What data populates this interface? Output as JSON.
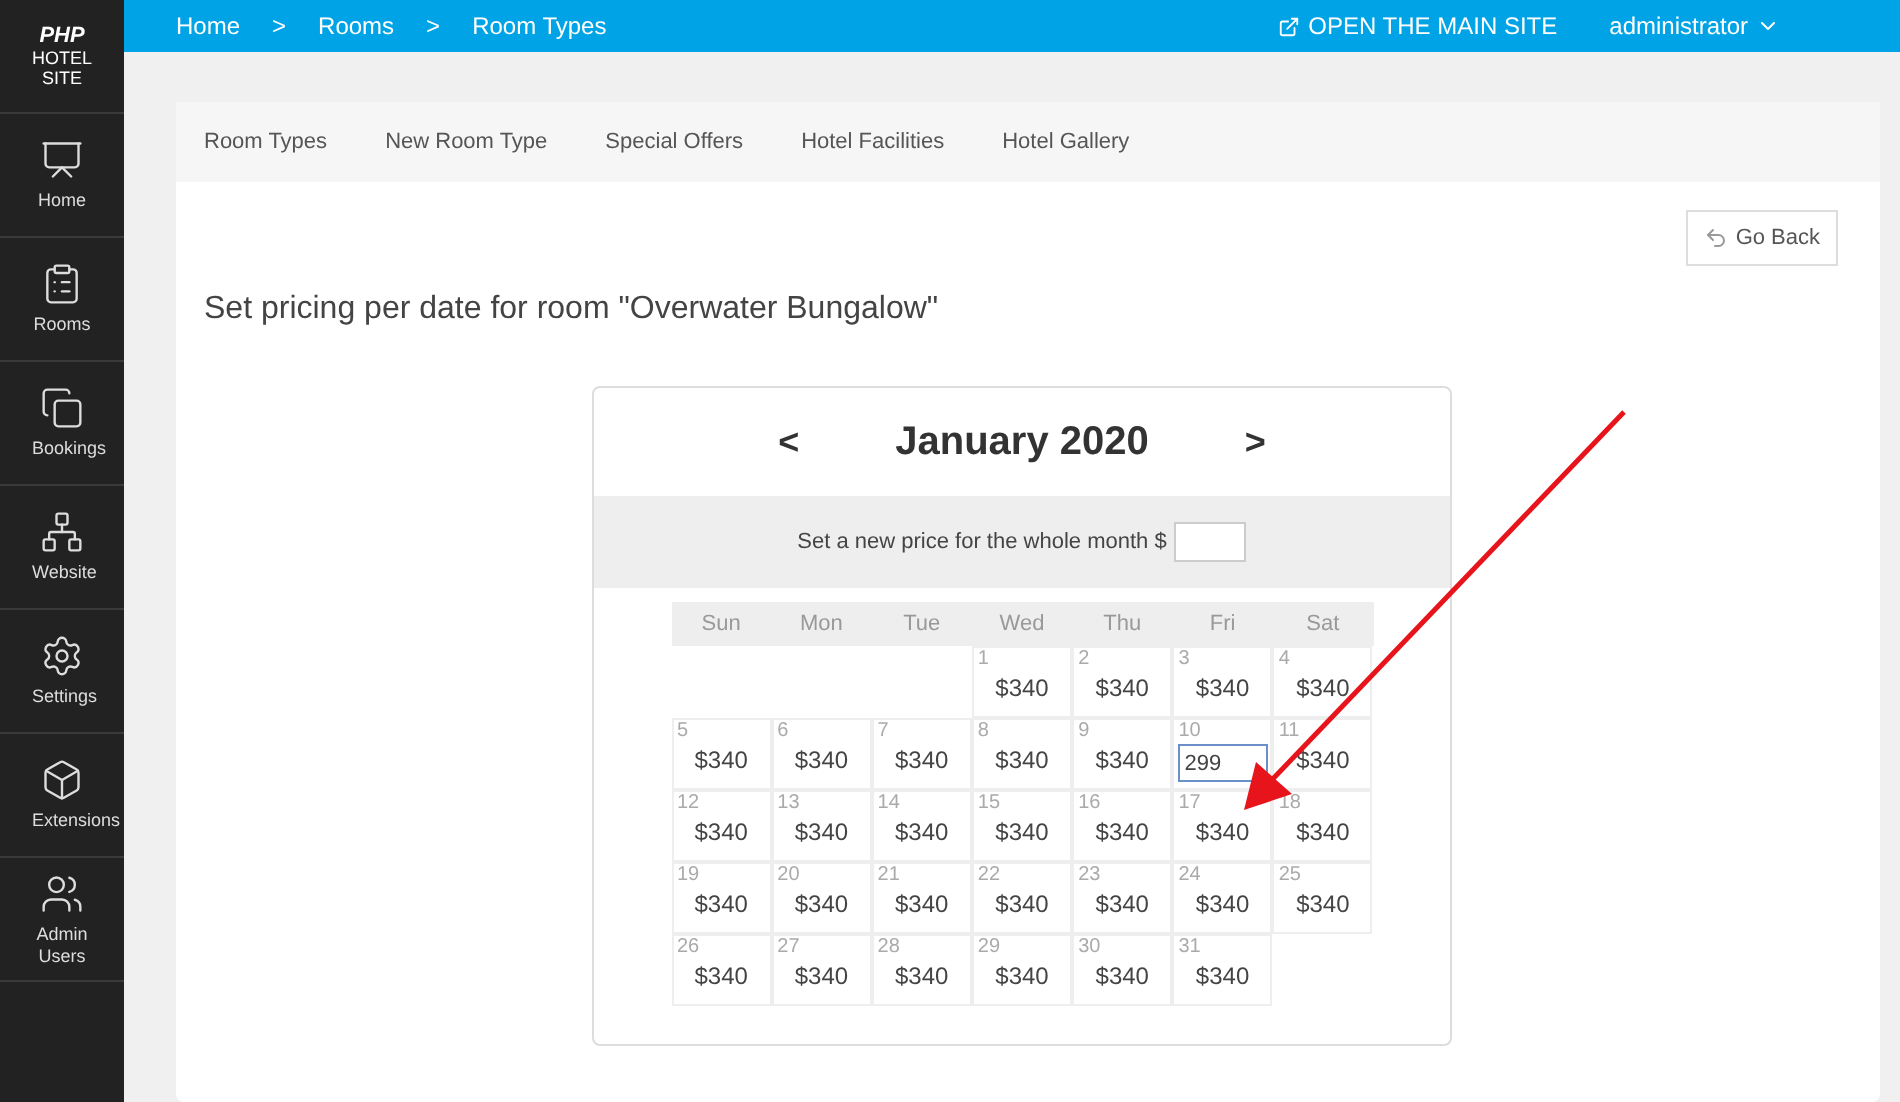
{
  "logo": {
    "line1": "PHP",
    "line2": "HOTEL",
    "line3": "SITE"
  },
  "sidebar": {
    "items": [
      {
        "label": "Home"
      },
      {
        "label": "Rooms"
      },
      {
        "label": "Bookings"
      },
      {
        "label": "Website"
      },
      {
        "label": "Settings"
      },
      {
        "label": "Extensions"
      },
      {
        "label": "Admin Users"
      }
    ]
  },
  "breadcrumb": [
    {
      "label": "Home"
    },
    {
      "label": ">"
    },
    {
      "label": "Rooms"
    },
    {
      "label": ">"
    },
    {
      "label": "Room Types"
    }
  ],
  "top_links": {
    "open_site": "OPEN THE MAIN SITE",
    "user": "administrator"
  },
  "tabs": [
    {
      "label": "Room Types"
    },
    {
      "label": "New Room Type"
    },
    {
      "label": "Special Offers"
    },
    {
      "label": "Hotel Facilities"
    },
    {
      "label": "Hotel Gallery"
    }
  ],
  "go_back": "Go Back",
  "heading": "Set pricing per date for room \"Overwater Bungalow\"",
  "calendar": {
    "prev": "<",
    "month": "January 2020",
    "next": ">",
    "month_price_label": "Set a new price for the whole month $",
    "weekdays": [
      "Sun",
      "Mon",
      "Tue",
      "Wed",
      "Thu",
      "Fri",
      "Sat"
    ],
    "weeks": [
      [
        {
          "kind": "empty"
        },
        {
          "kind": "empty"
        },
        {
          "kind": "empty"
        },
        {
          "kind": "day",
          "day": "1",
          "price": "$340"
        },
        {
          "kind": "day",
          "day": "2",
          "price": "$340"
        },
        {
          "kind": "day",
          "day": "3",
          "price": "$340"
        },
        {
          "kind": "day",
          "day": "4",
          "price": "$340"
        }
      ],
      [
        {
          "kind": "day",
          "day": "5",
          "price": "$340"
        },
        {
          "kind": "day",
          "day": "6",
          "price": "$340"
        },
        {
          "kind": "day",
          "day": "7",
          "price": "$340"
        },
        {
          "kind": "day",
          "day": "8",
          "price": "$340"
        },
        {
          "kind": "day",
          "day": "9",
          "price": "$340"
        },
        {
          "kind": "edit",
          "day": "10",
          "value": "299"
        },
        {
          "kind": "day",
          "day": "11",
          "price": "$340"
        }
      ],
      [
        {
          "kind": "day",
          "day": "12",
          "price": "$340"
        },
        {
          "kind": "day",
          "day": "13",
          "price": "$340"
        },
        {
          "kind": "day",
          "day": "14",
          "price": "$340"
        },
        {
          "kind": "day",
          "day": "15",
          "price": "$340"
        },
        {
          "kind": "day",
          "day": "16",
          "price": "$340"
        },
        {
          "kind": "day",
          "day": "17",
          "price": "$340"
        },
        {
          "kind": "day",
          "day": "18",
          "price": "$340"
        }
      ],
      [
        {
          "kind": "day",
          "day": "19",
          "price": "$340"
        },
        {
          "kind": "day",
          "day": "20",
          "price": "$340"
        },
        {
          "kind": "day",
          "day": "21",
          "price": "$340"
        },
        {
          "kind": "day",
          "day": "22",
          "price": "$340"
        },
        {
          "kind": "day",
          "day": "23",
          "price": "$340"
        },
        {
          "kind": "day",
          "day": "24",
          "price": "$340"
        },
        {
          "kind": "day",
          "day": "25",
          "price": "$340"
        }
      ],
      [
        {
          "kind": "day",
          "day": "26",
          "price": "$340"
        },
        {
          "kind": "day",
          "day": "27",
          "price": "$340"
        },
        {
          "kind": "day",
          "day": "28",
          "price": "$340"
        },
        {
          "kind": "day",
          "day": "29",
          "price": "$340"
        },
        {
          "kind": "day",
          "day": "30",
          "price": "$340"
        },
        {
          "kind": "day",
          "day": "31",
          "price": "$340"
        },
        {
          "kind": "empty"
        }
      ]
    ]
  }
}
